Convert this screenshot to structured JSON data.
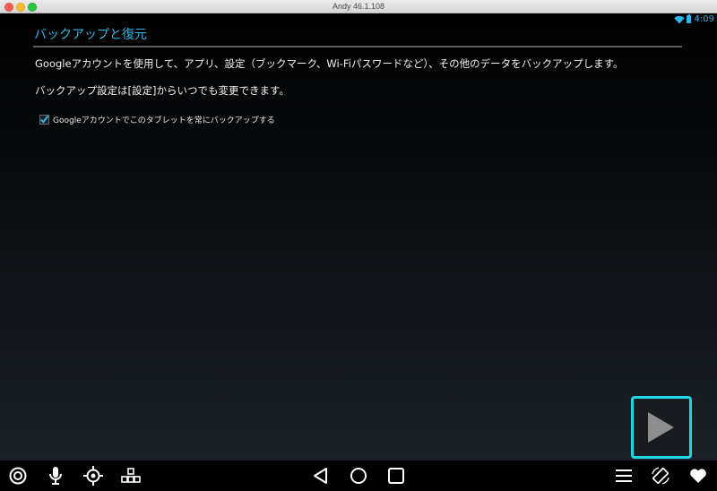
{
  "window": {
    "title": "Andy 46.1.108"
  },
  "status_bar": {
    "time": "4:09",
    "wifi_icon": "wifi-icon",
    "battery_icon": "battery-icon"
  },
  "page": {
    "title": "バックアップと復元",
    "paragraph1": "Googleアカウントを使用して、アプリ、設定（ブックマーク、Wi-Fiパスワードなど）、その他のデータをバックアップします。",
    "paragraph2": "バックアップ設定は[設定]からいつでも変更できます。",
    "checkbox": {
      "label": "Googleアカウントでこのタブレットを常にバックアップする",
      "checked": true
    },
    "next_button_icon": "play-arrow-icon"
  },
  "nav_bar": {
    "left": [
      "target-icon",
      "microphone-icon",
      "gps-crosshair-icon",
      "keyboard-keys-icon"
    ],
    "center": [
      "back-icon",
      "home-icon",
      "recents-icon"
    ],
    "right": [
      "menu-icon",
      "rotate-icon",
      "heart-icon"
    ]
  },
  "colors": {
    "accent": "#33b5e5",
    "next_button_border": "#1fd6e6"
  }
}
